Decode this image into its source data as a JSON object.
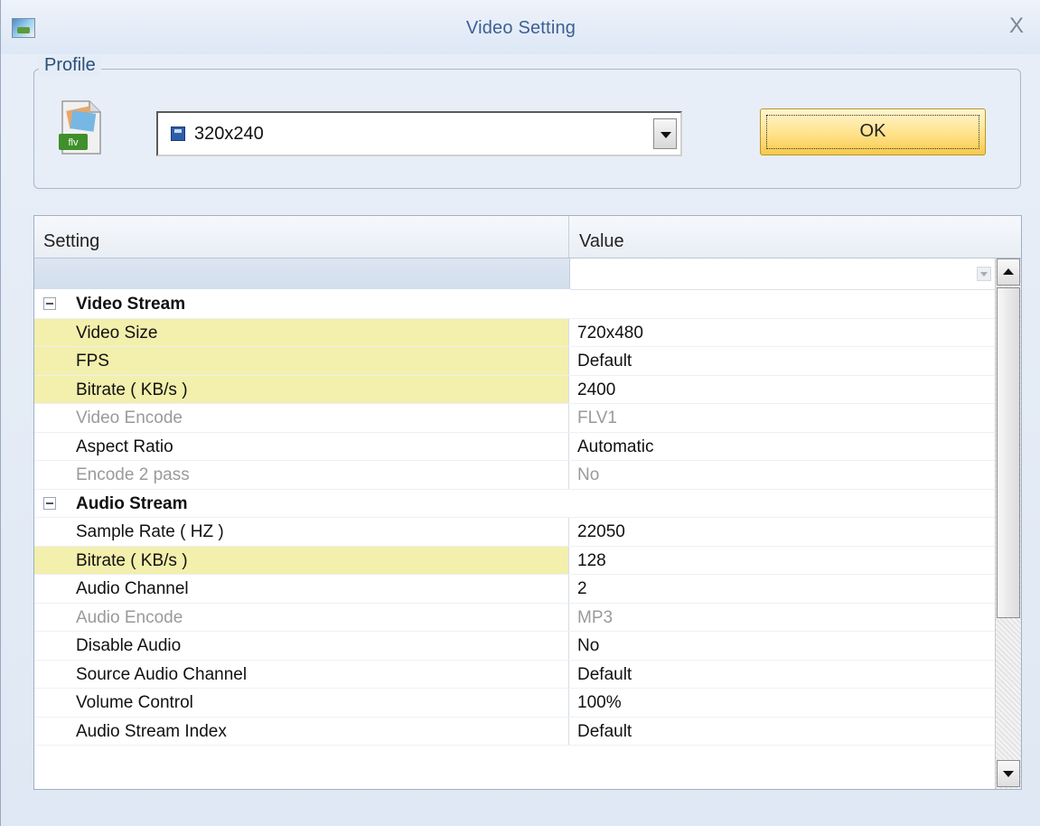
{
  "window": {
    "title": "Video Setting",
    "close_glyph": "X",
    "icons": {
      "app": "video-setting-icon",
      "close": "close-icon"
    }
  },
  "profile": {
    "legend": "Profile",
    "format_icon": "flv-file-icon",
    "format_icon_text": "flv",
    "selected": "320x240",
    "ok_label": "OK"
  },
  "grid": {
    "headers": {
      "setting": "Setting",
      "value": "Value"
    },
    "groups": [
      {
        "title": "Video Stream",
        "rows": [
          {
            "setting": "Video Size",
            "value": "720x480",
            "highlight": true,
            "dim": false
          },
          {
            "setting": "FPS",
            "value": "Default",
            "highlight": true,
            "dim": false
          },
          {
            "setting": "Bitrate ( KB/s )",
            "value": "2400",
            "highlight": true,
            "dim": false
          },
          {
            "setting": "Video Encode",
            "value": "FLV1",
            "highlight": false,
            "dim": true
          },
          {
            "setting": "Aspect Ratio",
            "value": "Automatic",
            "highlight": false,
            "dim": false
          },
          {
            "setting": "Encode 2 pass",
            "value": "No",
            "highlight": false,
            "dim": true
          }
        ]
      },
      {
        "title": "Audio Stream",
        "rows": [
          {
            "setting": "Sample Rate ( HZ )",
            "value": "22050",
            "highlight": false,
            "dim": false
          },
          {
            "setting": "Bitrate ( KB/s )",
            "value": "128",
            "highlight": true,
            "dim": false
          },
          {
            "setting": "Audio Channel",
            "value": "2",
            "highlight": false,
            "dim": false
          },
          {
            "setting": "Audio Encode",
            "value": "MP3",
            "highlight": false,
            "dim": true
          },
          {
            "setting": "Disable Audio",
            "value": "No",
            "highlight": false,
            "dim": false
          },
          {
            "setting": "Source Audio Channel",
            "value": "Default",
            "highlight": false,
            "dim": false
          },
          {
            "setting": "Volume Control",
            "value": "100%",
            "highlight": false,
            "dim": false
          },
          {
            "setting": "Audio Stream Index",
            "value": "Default",
            "highlight": false,
            "dim": false
          }
        ]
      }
    ]
  },
  "colors": {
    "title_text": "#3d5f93",
    "highlight_row": "#f3efac",
    "dim_text": "#9a9a9a",
    "ok_button": "#ffe28a"
  }
}
